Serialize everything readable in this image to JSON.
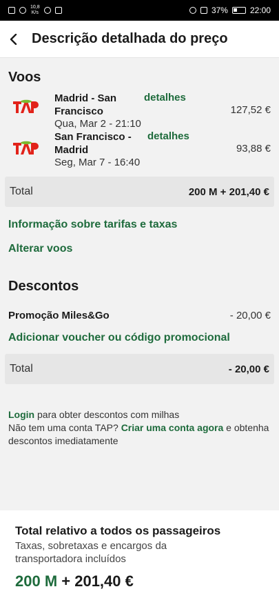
{
  "status_bar": {
    "speed_value": "10,8",
    "speed_unit": "K/s",
    "battery": "37%",
    "time": "22:00"
  },
  "header": {
    "title": "Descrição detalhada do preço"
  },
  "flights": {
    "title": "Voos",
    "items": [
      {
        "route": "Madrid - San Francisco",
        "date": "Qua, Mar 2 - 21:10",
        "details": "detalhes",
        "price": "127,52 €"
      },
      {
        "route": "San Francisco - Madrid",
        "date": "Seg, Mar 7 - 16:40",
        "details": "detalhes",
        "price": "93,88 €"
      }
    ],
    "total_label": "Total",
    "total_value": "200 M + 201,40 €"
  },
  "links": {
    "fares_info": "Informação sobre tarifas e taxas",
    "change_flights": "Alterar voos"
  },
  "discounts": {
    "title": "Descontos",
    "promo_label": "Promoção Miles&Go",
    "promo_value": "- 20,00 €",
    "add_voucher": "Adicionar voucher ou código promocional",
    "total_label": "Total",
    "total_value": "- 20,00 €"
  },
  "login": {
    "login_link": "Login",
    "login_rest": " para obter descontos com milhas",
    "no_account": "Não tem uma conta TAP? ",
    "create_link": "Criar uma conta agora",
    "create_rest": " e obtenha descontos imediatamente"
  },
  "footer": {
    "title": "Total relativo a todos os passageiros",
    "subtitle": "Taxas, sobretaxas e encargos da transportadora incluídos",
    "total_miles": "200 M",
    "total_rest": " + 201,40 €"
  },
  "colors": {
    "accent_green": "#1e6b3c",
    "tap_red": "#e2231a",
    "tap_green": "#7ab82e"
  }
}
